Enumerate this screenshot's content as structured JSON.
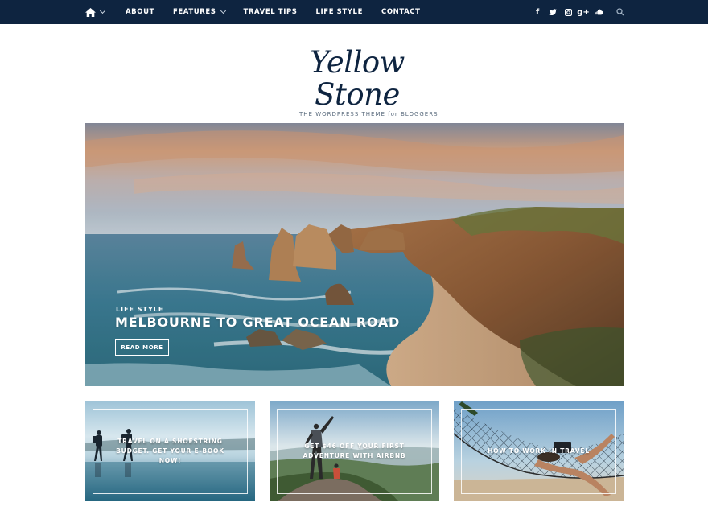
{
  "nav": {
    "items": [
      {
        "label": "ABOUT",
        "has_dropdown": false
      },
      {
        "label": "FEATURES",
        "has_dropdown": true
      },
      {
        "label": "TRAVEL TIPS",
        "has_dropdown": false
      },
      {
        "label": "LIFE STYLE",
        "has_dropdown": false
      },
      {
        "label": "CONTACT",
        "has_dropdown": false
      }
    ],
    "social": [
      {
        "icon": "facebook-icon",
        "glyph": "f"
      },
      {
        "icon": "twitter-icon",
        "glyph": "t"
      },
      {
        "icon": "instagram-icon",
        "glyph": "◘"
      },
      {
        "icon": "google-plus-icon",
        "glyph": "g+"
      },
      {
        "icon": "soundcloud-icon",
        "glyph": "☁"
      }
    ]
  },
  "logo": {
    "script": "Yellow Stone",
    "tagline": "THE WORDPRESS THEME for BLOGGERS"
  },
  "hero": {
    "category": "LIFE STYLE",
    "title": "MELBOURNE TO GREAT OCEAN ROAD",
    "button": "READ MORE"
  },
  "cards": [
    {
      "title": "TRAVEL ON A SHOESTRING BUDGET. GET YOUR E-BOOK NOW!"
    },
    {
      "title": "GET $46 OFF YOUR FIRST ADVENTURE WITH AIRBNB"
    },
    {
      "title": "HOW TO WORK IN TRAVEL"
    }
  ],
  "colors": {
    "topbar": "#0e2440",
    "logo": "#0e2440",
    "white": "#ffffff"
  }
}
